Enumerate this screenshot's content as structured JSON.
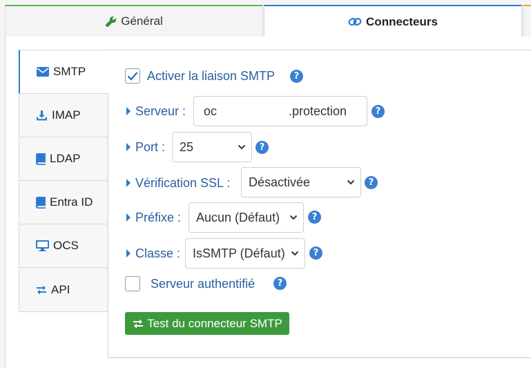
{
  "tabs": {
    "general": "Général",
    "connectors": "Connecteurs"
  },
  "nav": [
    {
      "label": "SMTP",
      "icon": "envelope-icon"
    },
    {
      "label": "IMAP",
      "icon": "download-icon"
    },
    {
      "label": "LDAP",
      "icon": "book-icon"
    },
    {
      "label": "Entra ID",
      "icon": "book-icon"
    },
    {
      "label": "OCS",
      "icon": "desktop-icon"
    },
    {
      "label": "API",
      "icon": "exchange-icon"
    }
  ],
  "form": {
    "enable_smtp": {
      "label": "Activer la liaison SMTP",
      "checked": true
    },
    "server": {
      "label": "Serveur :",
      "value_start": "oc",
      "value_end": ".protection"
    },
    "port": {
      "label": "Port :",
      "value": "25"
    },
    "ssl": {
      "label": "Vérification SSL :",
      "value": "Désactivée"
    },
    "prefix": {
      "label": "Préfixe :",
      "value": "Aucun (Défaut)"
    },
    "class": {
      "label": "Classe :",
      "value": "IsSMTP (Défaut)"
    },
    "auth": {
      "label": "Serveur authentifié",
      "checked": false
    },
    "test_button": "Test du connecteur SMTP"
  },
  "help_glyph": "?",
  "colors": {
    "accent": "#2a7bd0",
    "success": "#3c9a3c",
    "general_tab": "#5cb85c"
  }
}
